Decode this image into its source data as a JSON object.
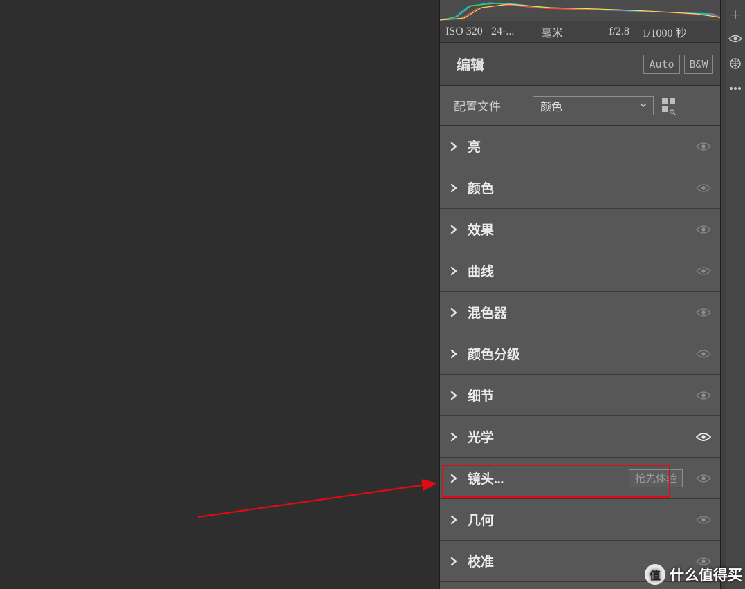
{
  "metadata": {
    "iso": "ISO 320",
    "focal": "24-...",
    "mm": "毫米",
    "aperture": "f/2.8",
    "shutter": "1/1000 秒"
  },
  "edit_header": {
    "title": "编辑",
    "auto_label": "Auto",
    "bw_label": "B&W"
  },
  "profile": {
    "label": "配置文件",
    "selected": "颜色"
  },
  "panels": [
    {
      "label": "亮"
    },
    {
      "label": "颜色"
    },
    {
      "label": "效果"
    },
    {
      "label": "曲线"
    },
    {
      "label": "混色器"
    },
    {
      "label": "颜色分级"
    },
    {
      "label": "细节"
    },
    {
      "label": "光学"
    },
    {
      "label": "镜头...",
      "badge": "抢先体验"
    },
    {
      "label": "几何"
    },
    {
      "label": "校准"
    }
  ],
  "watermark": {
    "badge": "值",
    "text": "什么值得买"
  }
}
